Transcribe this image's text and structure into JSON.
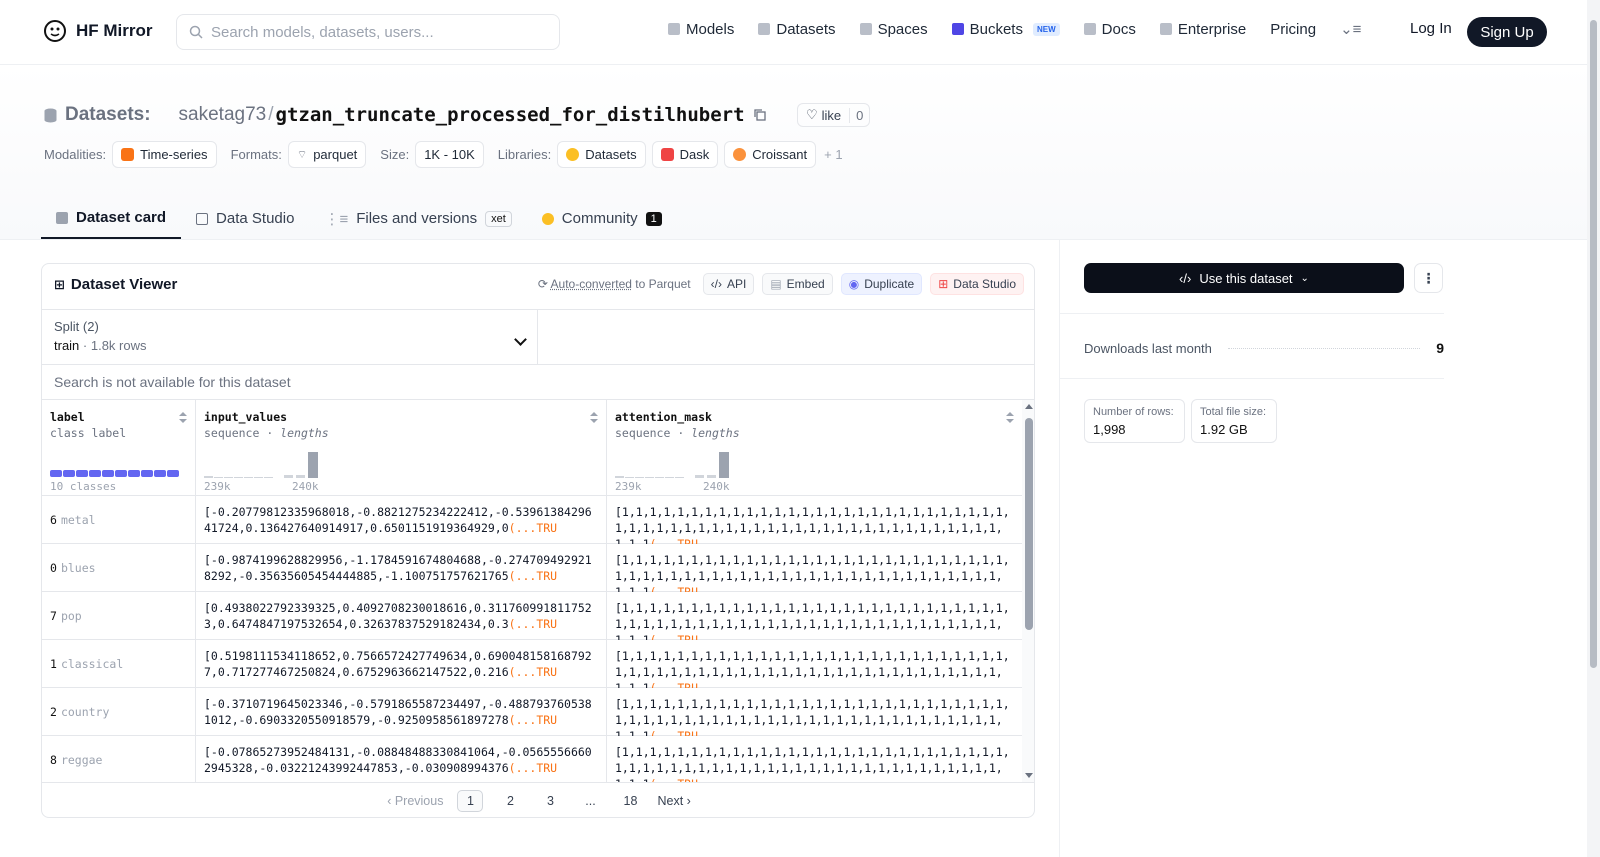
{
  "nav": {
    "brand": "HF Mirror",
    "search_placeholder": "Search models, datasets, users...",
    "links": [
      {
        "label": "Models",
        "icon": "cube-icon"
      },
      {
        "label": "Datasets",
        "icon": "database-icon"
      },
      {
        "label": "Spaces",
        "icon": "grid-icon"
      },
      {
        "label": "Buckets",
        "icon": "bucket-icon",
        "badge": "NEW"
      },
      {
        "label": "Docs",
        "icon": "book-icon"
      },
      {
        "label": "Enterprise",
        "icon": "enterprise-icon"
      },
      {
        "label": "Pricing"
      }
    ],
    "login": "Log In",
    "signup": "Sign Up"
  },
  "header": {
    "datasets_label": "Datasets:",
    "owner": "saketag73",
    "separator": "/",
    "repo": "gtzan_truncate_processed_for_distilhubert",
    "like_label": "like",
    "like_count": "0",
    "modalities_label": "Modalities:",
    "modality": "Time-series",
    "formats_label": "Formats:",
    "format": "parquet",
    "size_label": "Size:",
    "size": "1K - 10K",
    "libraries_label": "Libraries:",
    "libraries": [
      "Datasets",
      "Dask",
      "Croissant"
    ],
    "more_libs": "+ 1"
  },
  "tabs": [
    {
      "label": "Dataset card",
      "active": true
    },
    {
      "label": "Data Studio"
    },
    {
      "label": "Files and versions",
      "badge": "xet"
    },
    {
      "label": "Community",
      "count": "1"
    }
  ],
  "viewer": {
    "title": "Dataset Viewer",
    "autoconverted_link": "Auto-converted",
    "autoconverted_rest": " to Parquet",
    "api": "API",
    "embed": "Embed",
    "duplicate": "Duplicate",
    "data_studio": "Data Studio",
    "split_label": "Split (2)",
    "split_value": "train",
    "split_rows": "· 1.8k rows",
    "search_na": "Search is not available for this dataset",
    "columns": [
      {
        "name": "label",
        "type": "class label",
        "type_extra": "",
        "footer": "10 classes"
      },
      {
        "name": "input_values",
        "type": "sequence",
        "type_extra": "lengths",
        "hist_min": "239k",
        "hist_max": "240k"
      },
      {
        "name": "attention_mask",
        "type": "sequence",
        "type_extra": "lengths",
        "hist_min": "239k",
        "hist_max": "240k"
      }
    ],
    "rows": [
      {
        "label_id": "6",
        "label_name": "metal",
        "input": "[-0.20779812335968018,-0.8821275234222412,-0.5396138429641724,0.136427640914917,0.6501151919364929,0",
        "mask": "[1,1,1,1,1,1,1,1,1,1,1,1,1,1,1,1,1,1,1,1,1,1,1,1,1,1,1,1,1,1,1,1,1,1,1,1,1,1,1,1,1,1,1,1,1,1,1,1,1,1,1,1,1,1,1,1,1,1,1"
      },
      {
        "label_id": "0",
        "label_name": "blues",
        "input": "[-0.9874199628829956,-1.1784591674804688,-0.2747094929218292,-0.35635605454444885,-1.100751757621765",
        "mask": "[1,1,1,1,1,1,1,1,1,1,1,1,1,1,1,1,1,1,1,1,1,1,1,1,1,1,1,1,1,1,1,1,1,1,1,1,1,1,1,1,1,1,1,1,1,1,1,1,1,1,1,1,1,1,1,1,1,1,1"
      },
      {
        "label_id": "7",
        "label_name": "pop",
        "input": "[0.4938022792339325,0.4092708230018616,0.3117609918117523,0.6474847197532654,0.32637837529182434,0.3",
        "mask": "[1,1,1,1,1,1,1,1,1,1,1,1,1,1,1,1,1,1,1,1,1,1,1,1,1,1,1,1,1,1,1,1,1,1,1,1,1,1,1,1,1,1,1,1,1,1,1,1,1,1,1,1,1,1,1,1,1,1,1"
      },
      {
        "label_id": "1",
        "label_name": "classical",
        "input": "[0.5198111534118652,0.7566572427749634,0.6900481581687927,0.717277467250824,0.6752963662147522,0.216",
        "mask": "[1,1,1,1,1,1,1,1,1,1,1,1,1,1,1,1,1,1,1,1,1,1,1,1,1,1,1,1,1,1,1,1,1,1,1,1,1,1,1,1,1,1,1,1,1,1,1,1,1,1,1,1,1,1,1,1,1,1,1"
      },
      {
        "label_id": "2",
        "label_name": "country",
        "input": "[-0.3710719645023346,-0.5791865587234497,-0.4887937605381012,-0.6903320550918579,-0.9250958561897278",
        "mask": "[1,1,1,1,1,1,1,1,1,1,1,1,1,1,1,1,1,1,1,1,1,1,1,1,1,1,1,1,1,1,1,1,1,1,1,1,1,1,1,1,1,1,1,1,1,1,1,1,1,1,1,1,1,1,1,1,1,1,1"
      },
      {
        "label_id": "8",
        "label_name": "reggae",
        "input": "[-0.07865273952484131,-0.08848488330841064,-0.05655566602945328,-0.03221243992447853,-0.030908994376",
        "mask": "[1,1,1,1,1,1,1,1,1,1,1,1,1,1,1,1,1,1,1,1,1,1,1,1,1,1,1,1,1,1,1,1,1,1,1,1,1,1,1,1,1,1,1,1,1,1,1,1,1,1,1,1,1,1,1,1,1,1,1"
      }
    ],
    "truncated": "(...TRU",
    "pager": {
      "prev": "Previous",
      "pages": [
        "1",
        "2",
        "3",
        "...",
        "18"
      ],
      "current": "1",
      "next": "Next"
    }
  },
  "sidebar": {
    "use_button": "Use this dataset",
    "downloads_label": "Downloads last month",
    "downloads_value": "9",
    "rows_label": "Number of rows:",
    "rows_value": "1,998",
    "filesize_label": "Total file size:",
    "filesize_value": "1.92 GB"
  }
}
